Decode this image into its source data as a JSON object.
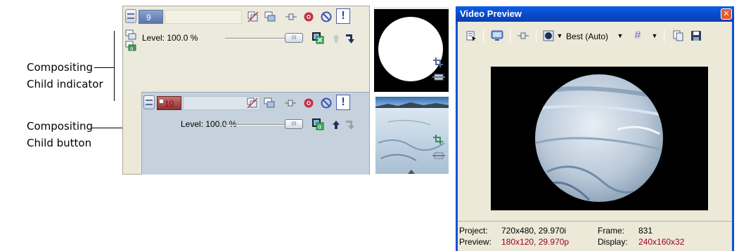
{
  "callouts": {
    "indicator_line1": "Compositing",
    "indicator_line2": "Child indicator",
    "button_line1": "Compositing",
    "button_line2": "Child button"
  },
  "track1": {
    "number": "9",
    "level": "Level: 100.0 %",
    "level_percent": 100
  },
  "track2": {
    "number": "10",
    "level": "Level: 100.0 %",
    "level_percent": 100
  },
  "preview": {
    "title": "Video Preview",
    "close_glyph": "✕",
    "quality": "Best (Auto)",
    "status": {
      "project_label": "Project:",
      "project_value": "720x480, 29.970i",
      "frame_label": "Frame:",
      "frame_value": "831",
      "preview_label": "Preview:",
      "preview_value": "180x120, 29.970p",
      "display_label": "Display:",
      "display_value": "240x160x32"
    }
  },
  "colors": {
    "title_bar": "#0a53d8",
    "status_red": "#a0001c",
    "track1_bg": "#eceadc",
    "track2_bg": "#c5d2dd"
  },
  "icons": {
    "track_header": [
      "collapse-icon",
      "bypass-motion-blur-icon",
      "composite-mode-icon",
      "track-motion-icon",
      "track-fx-icon",
      "mute-icon",
      "solo-icon"
    ],
    "preview_toolbar": [
      "preview-properties-icon",
      "external-monitor-icon",
      "split-screen-icon",
      "video-output-fx-icon",
      "overlays-icon",
      "copy-snapshot-icon",
      "save-snapshot-icon"
    ]
  }
}
